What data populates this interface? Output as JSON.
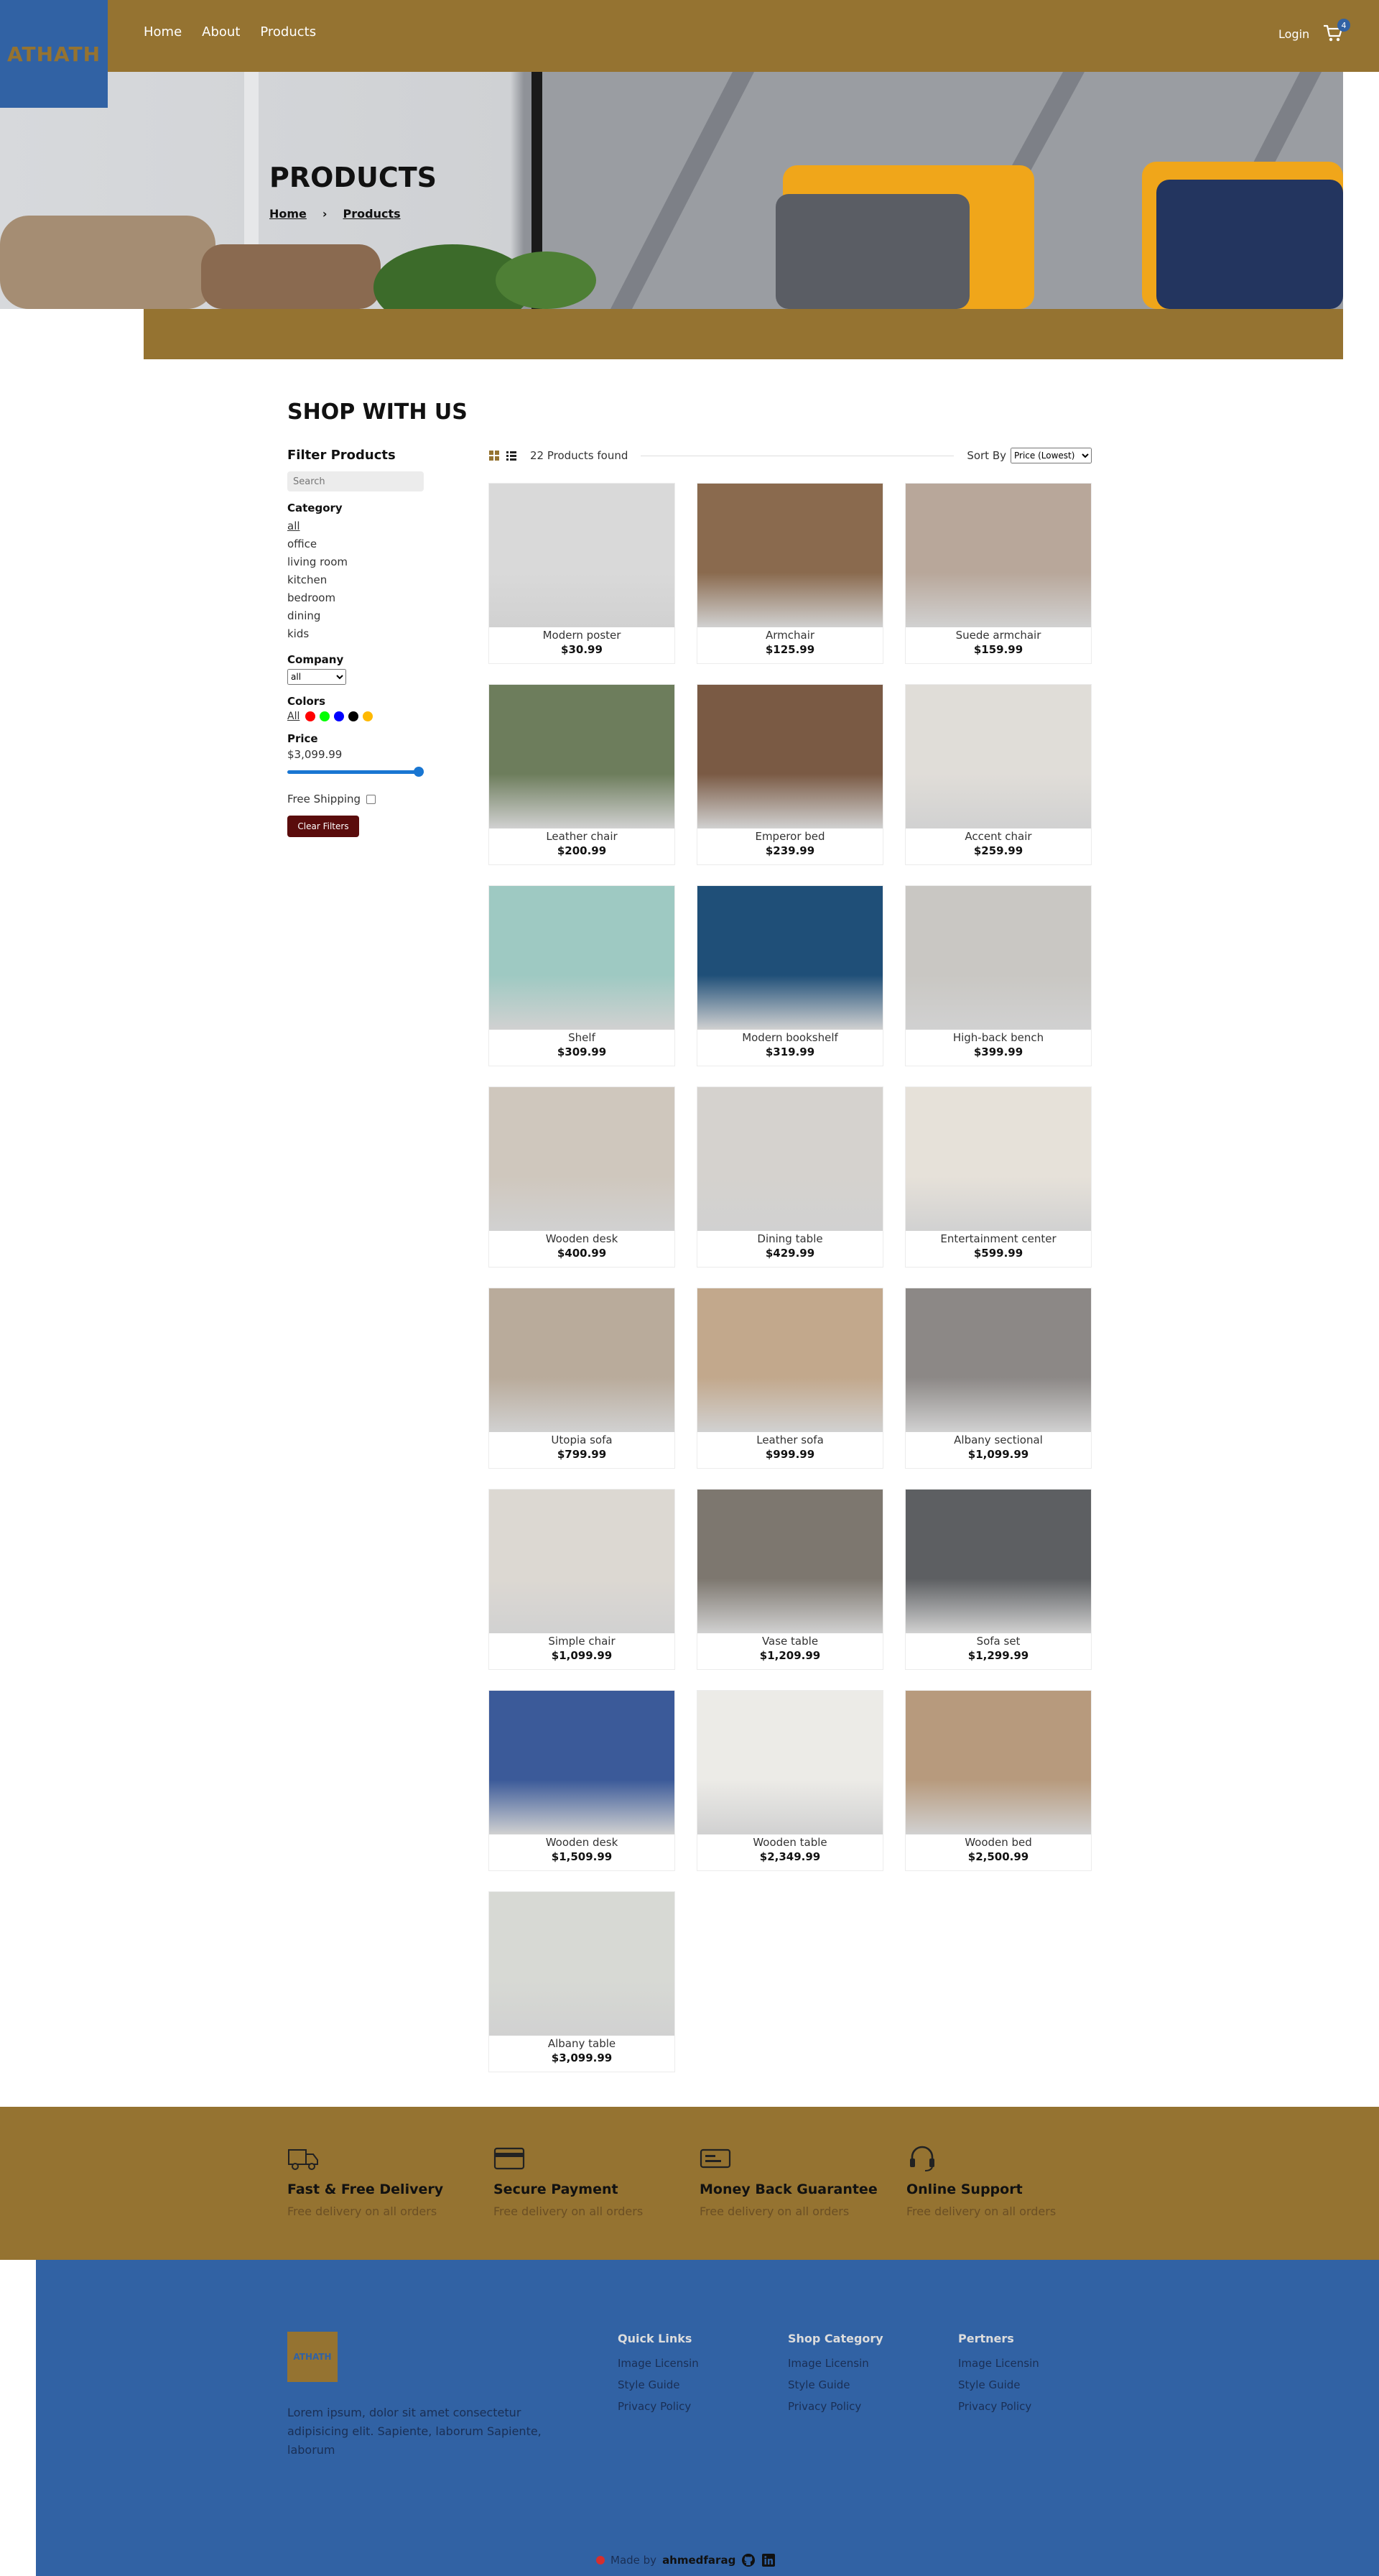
{
  "header": {
    "logo": "ATHATH",
    "nav": [
      "Home",
      "About",
      "Products"
    ],
    "login": "Login",
    "cart_count": "4"
  },
  "hero": {
    "title": "PRODUCTS",
    "breadcrumb": [
      "Home",
      "Products"
    ]
  },
  "shop": {
    "title": "SHOP WITH US",
    "filters": {
      "title": "Filter Products",
      "search_placeholder": "Search",
      "category_label": "Category",
      "categories": [
        "all",
        "office",
        "living room",
        "kitchen",
        "bedroom",
        "dining",
        "kids"
      ],
      "company_label": "Company",
      "company_value": "all",
      "colors_label": "Colors",
      "colors_all": "All",
      "colors": [
        "#ff0000",
        "#00ff00",
        "#0000ff",
        "#000000",
        "#ffb900"
      ],
      "price_label": "Price",
      "price_value": "$3,099.99",
      "price_fraction": 1.0,
      "shipping_label": "Free Shipping",
      "clear_button": "Clear Filters"
    },
    "toolbar": {
      "found": "22 Products found",
      "sort_label": "Sort By",
      "sort_value": "Price (Lowest)"
    },
    "products": [
      {
        "name": "Modern poster",
        "price": "$30.99",
        "color": "#d9d9d9"
      },
      {
        "name": "Armchair",
        "price": "$125.99",
        "color": "#8a6a4e"
      },
      {
        "name": "Suede armchair",
        "price": "$159.99",
        "color": "#b8a79a"
      },
      {
        "name": "Leather chair",
        "price": "$200.99",
        "color": "#6d7d5c"
      },
      {
        "name": "Emperor bed",
        "price": "$239.99",
        "color": "#7a5a44"
      },
      {
        "name": "Accent chair",
        "price": "$259.99",
        "color": "#e0ddd8"
      },
      {
        "name": "Shelf",
        "price": "$309.99",
        "color": "#9ec9c2"
      },
      {
        "name": "Modern bookshelf",
        "price": "$319.99",
        "color": "#1f4f78"
      },
      {
        "name": "High-back bench",
        "price": "$399.99",
        "color": "#c9c7c3"
      },
      {
        "name": "Wooden desk",
        "price": "$400.99",
        "color": "#cfc7bd"
      },
      {
        "name": "Dining table",
        "price": "$429.99",
        "color": "#d5d2ce"
      },
      {
        "name": "Entertainment center",
        "price": "$599.99",
        "color": "#e6e1d9"
      },
      {
        "name": "Utopia sofa",
        "price": "$799.99",
        "color": "#b9ab9b"
      },
      {
        "name": "Leather sofa",
        "price": "$999.99",
        "color": "#c2a88c"
      },
      {
        "name": "Albany sectional",
        "price": "$1,099.99",
        "color": "#8c8886"
      },
      {
        "name": "Simple chair",
        "price": "$1,099.99",
        "color": "#dcd8d2"
      },
      {
        "name": "Vase table",
        "price": "$1,209.99",
        "color": "#7d776f"
      },
      {
        "name": "Sofa set",
        "price": "$1,299.99",
        "color": "#5d5f62"
      },
      {
        "name": "Wooden desk",
        "price": "$1,509.99",
        "color": "#3b5a99"
      },
      {
        "name": "Wooden table",
        "price": "$2,349.99",
        "color": "#ecebe7"
      },
      {
        "name": "Wooden bed",
        "price": "$2,500.99",
        "color": "#b79a7d"
      },
      {
        "name": "Albany table",
        "price": "$3,099.99",
        "color": "#d7d9d4"
      }
    ]
  },
  "features": [
    {
      "title": "Fast & Free Delivery",
      "subtitle": "Free delivery on all orders",
      "icon": "truck-icon"
    },
    {
      "title": "Secure Payment",
      "subtitle": "Free delivery on all orders",
      "icon": "credit-card-icon"
    },
    {
      "title": "Money Back Guarantee",
      "subtitle": "Free delivery on all orders",
      "icon": "money-icon"
    },
    {
      "title": "Online Support",
      "subtitle": "Free delivery on all orders",
      "icon": "headset-icon"
    }
  ],
  "footer": {
    "logo": "ATHATH",
    "about": "Lorem ipsum, dolor sit amet consectetur adipisicing elit. Sapiente, laborum Sapiente, laborum",
    "columns": [
      {
        "title": "Quick Links",
        "items": [
          "Image Licensin",
          "Style Guide",
          "Privacy Policy"
        ]
      },
      {
        "title": "Shop Category",
        "items": [
          "Image Licensin",
          "Style Guide",
          "Privacy Policy"
        ]
      },
      {
        "title": "Pertners",
        "items": [
          "Image Licensin",
          "Style Guide",
          "Privacy Policy"
        ]
      }
    ],
    "made_by_prefix": "Made by",
    "made_by_name": "ahmedfarag"
  },
  "colors": {
    "brand_gold": "#957331",
    "brand_blue": "#3162a4",
    "clear_button": "#5a0c0c",
    "slider": "#1976d2"
  }
}
